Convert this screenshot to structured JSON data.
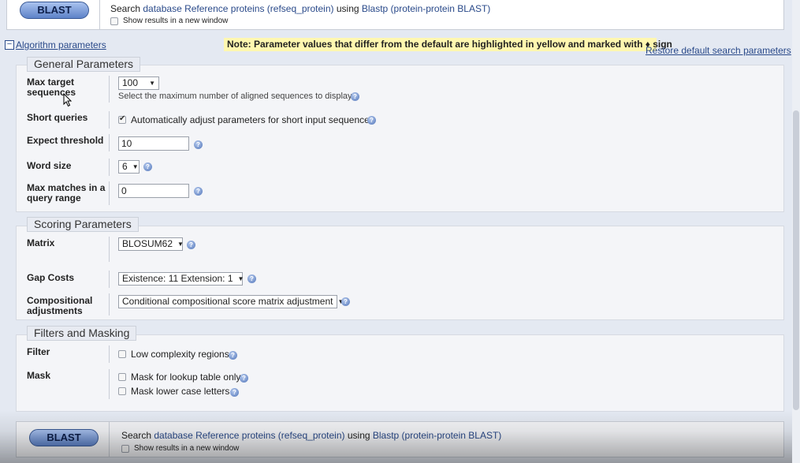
{
  "top": {
    "blast_label": "BLAST",
    "search_prefix": "Search ",
    "database": "database Reference proteins (refseq_protein)",
    "using": " using ",
    "program": "Blastp (protein-protein BLAST)",
    "new_window_label": "Show results in a new window"
  },
  "algorithm": {
    "toggle_label": "Algorithm parameters",
    "note": "Note: Parameter values that differ from the default are highlighted in yellow and marked with ♦ sign",
    "restore_label": "Restore default search parameters"
  },
  "general": {
    "legend": "General Parameters",
    "max_target": {
      "label": "Max target sequences",
      "value": "100",
      "hint": "Select the maximum number of aligned sequences to display"
    },
    "short_queries": {
      "label": "Short queries",
      "checkbox_label": "Automatically adjust parameters for short input sequences",
      "checked": true
    },
    "expect": {
      "label": "Expect threshold",
      "value": "10"
    },
    "word_size": {
      "label": "Word size",
      "value": "6"
    },
    "max_matches": {
      "label": "Max matches in a query range",
      "value": "0"
    }
  },
  "scoring": {
    "legend": "Scoring Parameters",
    "matrix": {
      "label": "Matrix",
      "value": "BLOSUM62"
    },
    "gap_costs": {
      "label": "Gap Costs",
      "value": "Existence: 11 Extension: 1"
    },
    "compositional": {
      "label": "Compositional adjustments",
      "value": "Conditional compositional score matrix adjustment"
    }
  },
  "filters": {
    "legend": "Filters and Masking",
    "filter_label": "Filter",
    "low_complexity": "Low complexity regions",
    "mask_label": "Mask",
    "mask_lookup": "Mask for lookup table only",
    "mask_lower": "Mask lower case letters"
  },
  "bottom": {
    "blast_label": "BLAST",
    "search_prefix": "Search ",
    "database": "database Reference proteins (refseq_protein)",
    "using": " using ",
    "program": "Blastp (protein-protein BLAST)",
    "new_window_label": "Show results in a new window"
  },
  "colors": {
    "link": "#2a4a8a",
    "note_bg": "#fff7b0",
    "page_bg": "#e4e9f2"
  }
}
